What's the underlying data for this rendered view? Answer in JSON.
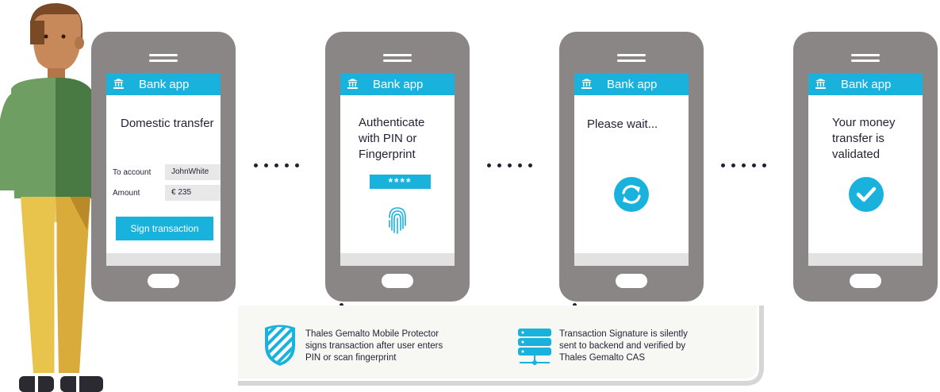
{
  "phones": [
    {
      "app_title": "Bank app",
      "heading": "Domestic transfer",
      "to_account_label": "To account",
      "to_account_value": "JohnWhite",
      "amount_label": "Amount",
      "amount_value": "€ 235",
      "button_label": "Sign transaction"
    },
    {
      "app_title": "Bank app",
      "heading_lines": [
        "Authenticate",
        "with PIN or",
        "Fingerprint"
      ],
      "pin_mask": "****",
      "icon": "fingerprint-icon"
    },
    {
      "app_title": "Bank app",
      "heading": "Please wait...",
      "icon": "refresh-icon"
    },
    {
      "app_title": "Bank app",
      "heading_lines": [
        "Your money",
        "transfer is",
        "validated"
      ],
      "icon": "checkmark-icon"
    }
  ],
  "captions": [
    {
      "icon": "shield-icon",
      "lines": [
        "Thales Gemalto Mobile Protector",
        "signs transaction after user enters",
        "PIN or scan fingerprint"
      ]
    },
    {
      "icon": "server-icon",
      "lines": [
        "Transaction Signature is silently",
        "sent to backend and verified by",
        "Thales Gemalto CAS"
      ]
    }
  ],
  "colors": {
    "accent": "#19b2dd",
    "phone_body": "#8a8685",
    "dots": "#1f2235",
    "shirt_light": "#6f9e62",
    "shirt_dark": "#4a7a43",
    "pants": "#e9c44c",
    "skin": "#c8895a",
    "hair": "#7a4a26"
  }
}
